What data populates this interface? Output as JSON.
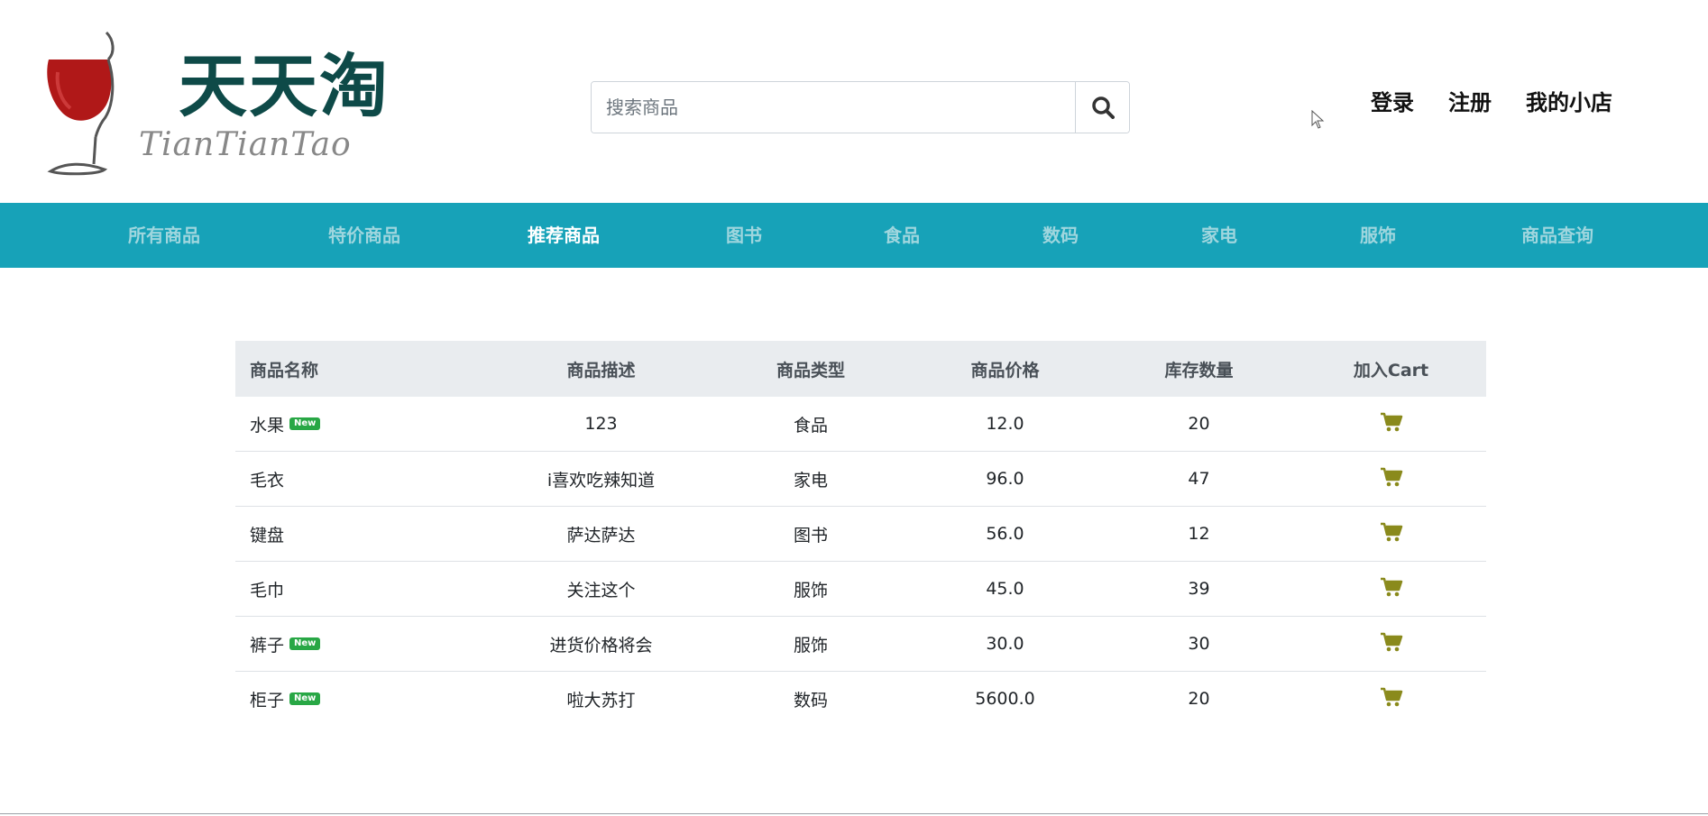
{
  "logo": {
    "title": "天天淘",
    "subtitle": "TianTianTao"
  },
  "search": {
    "placeholder": "搜索商品",
    "button_icon": "search-icon"
  },
  "top_links": [
    "登录",
    "注册",
    "我的小店"
  ],
  "nav": {
    "items": [
      "所有商品",
      "特价商品",
      "推荐商品",
      "图书",
      "食品",
      "数码",
      "家电",
      "服饰",
      "商品查询"
    ],
    "active": "推荐商品"
  },
  "table": {
    "headers": [
      "商品名称",
      "商品描述",
      "商品类型",
      "商品价格",
      "库存数量",
      "加入Cart"
    ],
    "rows": [
      {
        "name": "水果",
        "is_new": true,
        "description": "123",
        "type": "食品",
        "price": "12.0",
        "stock": "20"
      },
      {
        "name": "毛衣",
        "is_new": false,
        "description": "i喜欢吃辣知道",
        "type": "家电",
        "price": "96.0",
        "stock": "47"
      },
      {
        "name": "键盘",
        "is_new": false,
        "description": "萨达萨达",
        "type": "图书",
        "price": "56.0",
        "stock": "12"
      },
      {
        "name": "毛巾",
        "is_new": false,
        "description": "关注这个",
        "type": "服饰",
        "price": "45.0",
        "stock": "39"
      },
      {
        "name": "裤子",
        "is_new": true,
        "description": "进货价格将会",
        "type": "服饰",
        "price": "30.0",
        "stock": "30"
      },
      {
        "name": "柜子",
        "is_new": true,
        "description": "啦大苏打",
        "type": "数码",
        "price": "5600.0",
        "stock": "20"
      }
    ],
    "badge_label": "New",
    "cart_icon": "shopping-cart-icon"
  },
  "colors": {
    "brand_teal": "#17a2b8",
    "logo_green": "#0e4a48",
    "wine_red": "#b01818",
    "badge_green": "#28a745",
    "cart_olive": "#8a8a1c",
    "header_gray": "#e9ecef"
  }
}
